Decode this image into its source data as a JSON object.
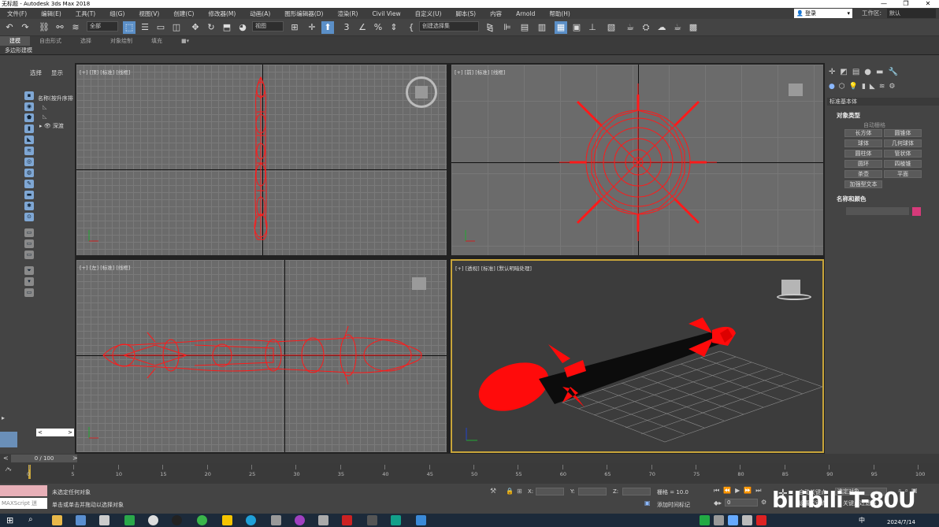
{
  "window": {
    "title": "无标题 - Autodesk 3ds Max 2018",
    "controls": [
      "—",
      "❐",
      "✕"
    ]
  },
  "menu": [
    "文件(F)",
    "编辑(E)",
    "工具(T)",
    "组(G)",
    "视图(V)",
    "创建(C)",
    "修改器(M)",
    "动画(A)",
    "图形编辑器(D)",
    "渲染(R)",
    "Civil View",
    "自定义(U)",
    "脚本(S)",
    "内容",
    "Arnold",
    "帮助(H)"
  ],
  "account": {
    "login": "登录",
    "workspace_label": "工作区:",
    "workspace_value": "默认"
  },
  "toolbar": {
    "filter_value": "全部",
    "view_value": "视图",
    "selection_set": "创建选择集"
  },
  "ribbon": {
    "tabs": [
      "建模",
      "自由形式",
      "选择",
      "对象绘制",
      "填充"
    ],
    "sub_label": "多边形建模"
  },
  "explorer": {
    "tabs": [
      "选择",
      "显示"
    ],
    "column_header": "名称(按升序排",
    "rows": [
      "",
      "",
      "深渡"
    ]
  },
  "viewports": {
    "top": "[+] [顶] [标准] [线框]",
    "front": "[+] [前] [标准] [线框]",
    "left": "[+] [左] [标准] [线框]",
    "persp": "[+] [透视] [标准] [默认明暗处理]"
  },
  "command_panel": {
    "category": "标准基本体",
    "object_type_header": "对象类型",
    "autogrid": "自动栅格",
    "buttons": [
      "长方体",
      "圆锥体",
      "球体",
      "几何球体",
      "圆柱体",
      "管状体",
      "圆环",
      "四棱锥",
      "茶壶",
      "平面",
      "加强型文本"
    ],
    "name_color_header": "名称和颜色",
    "color": "#d63a7a"
  },
  "timeline": {
    "frame_display": "0 / 100",
    "ticks": [
      "0",
      "5",
      "10",
      "15",
      "20",
      "25",
      "30",
      "35",
      "40",
      "45",
      "50",
      "55",
      "60",
      "65",
      "70",
      "75",
      "80",
      "85",
      "90",
      "95",
      "100"
    ]
  },
  "status": {
    "maxscript": "MAXScript 迷",
    "line1": "未选定任何对象",
    "line2": "单击或单击并拖动以选择对象",
    "x_label": "X:",
    "y_label": "Y:",
    "z_label": "Z:",
    "grid": "栅格 = 10.0",
    "add_time_tag": "添加时间标记",
    "auto_key": "自动关键点",
    "set_key": "设置关键点",
    "selected_object": "选定对象",
    "key_filter": "关键点过滤器",
    "frame_value": "0"
  },
  "taskbar": {
    "date": "2024/7/14",
    "ime": "中"
  },
  "watermark": "bilibili T-80U"
}
